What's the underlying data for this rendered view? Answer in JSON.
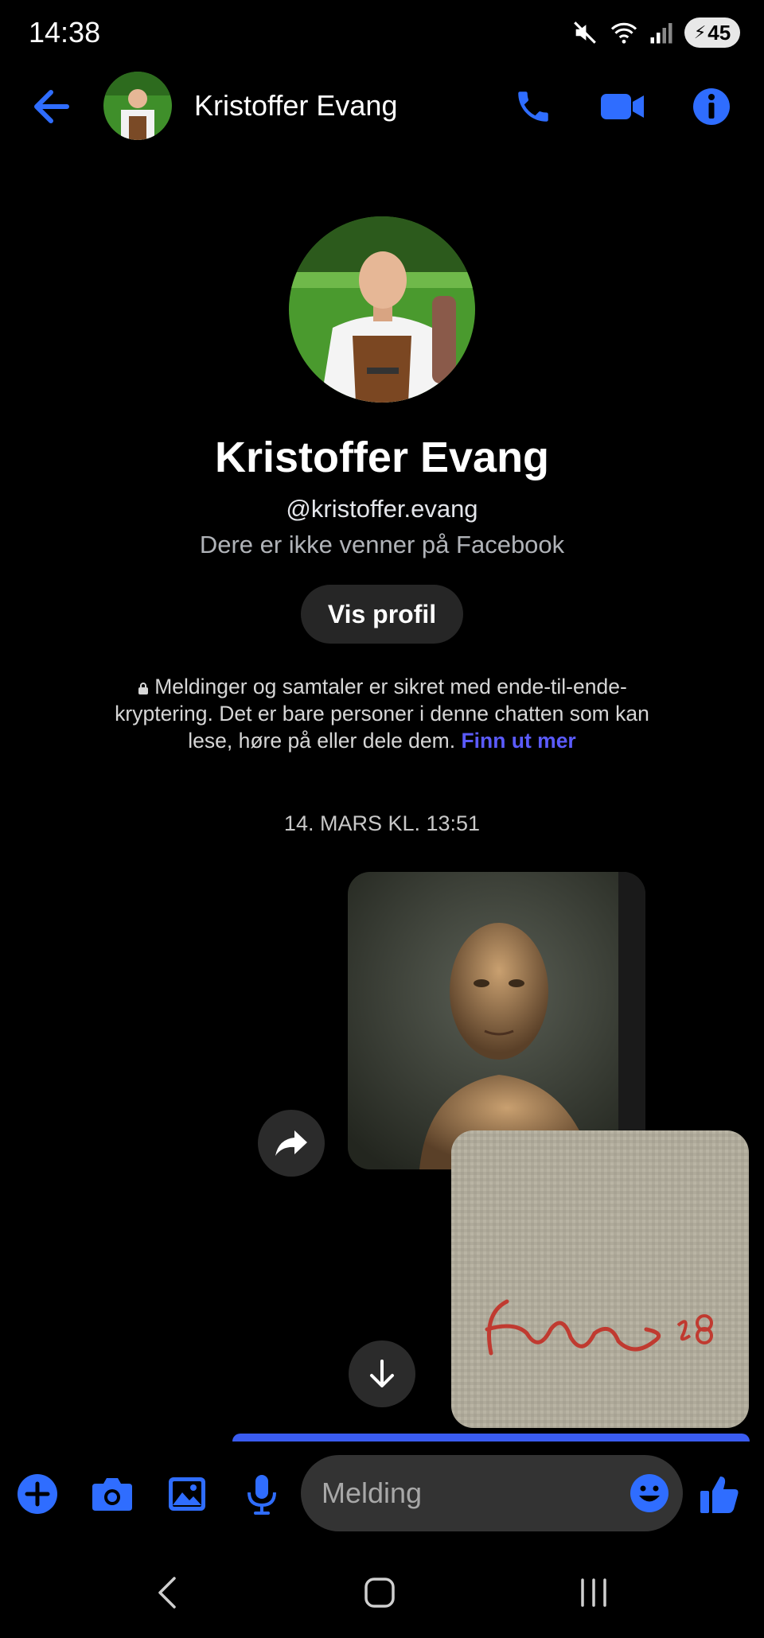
{
  "status_bar": {
    "time": "14:38",
    "battery": "45",
    "icons": [
      "mute-icon",
      "wifi-6e-icon",
      "signal-icon",
      "battery-icon"
    ]
  },
  "header": {
    "contact_name": "Kristoffer Evang",
    "icons": [
      "back-arrow-icon",
      "phone-icon",
      "video-icon",
      "info-icon"
    ]
  },
  "profile": {
    "name": "Kristoffer Evang",
    "handle": "@kristoffer.evang",
    "friend_status": "Dere er ikke venner på Facebook",
    "view_profile_label": "Vis profil"
  },
  "encryption": {
    "text": "Meldinger og samtaler er sikret med ende-til-ende-kryptering. Det er bare personer i denne chatten som kan lese, høre på eller dele dem.",
    "link": "Finn ut mer"
  },
  "conversation": {
    "date_separator": "14. MARS KL. 13:51",
    "attachments": [
      {
        "type": "image",
        "subject": "painted-portrait"
      },
      {
        "type": "image",
        "subject": "canvas-signature"
      }
    ]
  },
  "composer": {
    "placeholder": "Melding",
    "icons": [
      "plus-icon",
      "camera-icon",
      "gallery-icon",
      "microphone-icon",
      "emoji-icon",
      "thumbs-up-icon"
    ]
  },
  "colors": {
    "accent": "#1877f2",
    "background": "#000000",
    "bubble": "#333333"
  }
}
